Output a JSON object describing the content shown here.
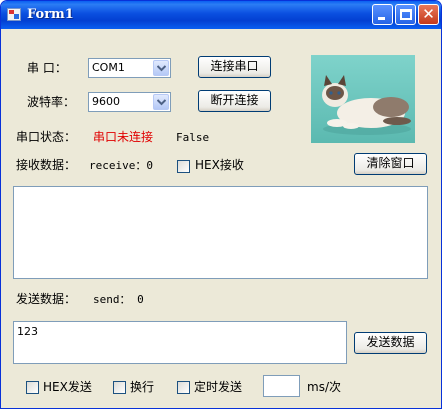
{
  "window": {
    "title": "Form1",
    "minimize_label": "",
    "close_symbol": "✕"
  },
  "serial": {
    "port_label": "串  口：",
    "port_value": "COM1",
    "baud_label": "波特率：",
    "baud_value": "9600",
    "connect_button": "连接串口",
    "disconnect_button": "断开连接",
    "status_label": "串口状态：",
    "status_value": "串口未连接",
    "status_flag": "False",
    "status_color": "#e00000"
  },
  "receive": {
    "label": "接收数据：",
    "counter": "receive：0",
    "hex_checkbox_label": "HEX接收",
    "clear_button": "清除窗口",
    "text": ""
  },
  "send": {
    "label": "发送数据：",
    "counter": "send：  0",
    "text": "123",
    "send_button": "发送数据",
    "hex_checkbox_label": "HEX发送",
    "newline_checkbox_label": "换行",
    "timed_checkbox_label": "定时发送",
    "interval_value": "",
    "interval_unit": "ms/次"
  },
  "picture": {
    "icon": "cat-photo"
  },
  "colors": {
    "titlebar": "#0a4fe0",
    "form_background": "#ece9d8",
    "button_border": "#003c74"
  }
}
